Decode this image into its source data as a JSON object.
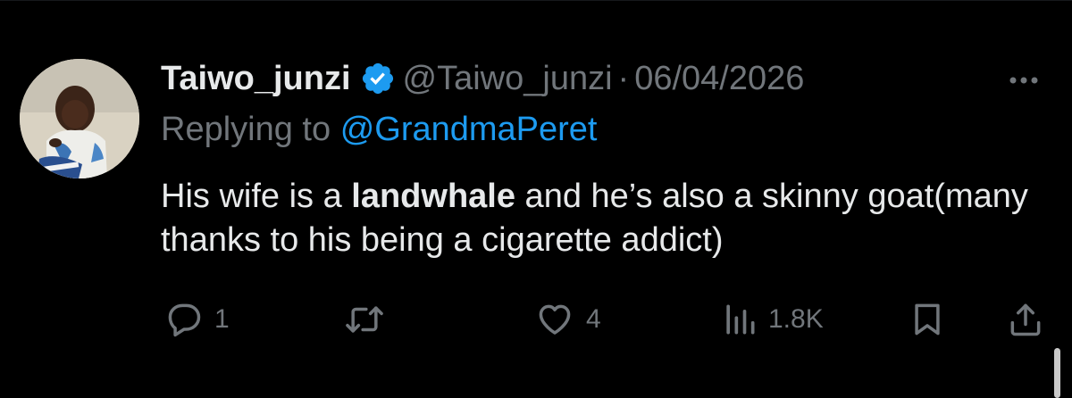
{
  "tweet": {
    "display_name": "Taiwo_junzi",
    "handle": "@Taiwo_junzi",
    "separator": "·",
    "date": "06/04/2026",
    "replying_prefix": "Replying to",
    "replying_to": "@GrandmaPeret",
    "text_part1": "His wife is a ",
    "text_bold": "landwhale",
    "text_part2": " and he’s also a skinny goat(many thanks to his being a cigarette addict)"
  },
  "actions": {
    "reply_count": "1",
    "retweet_count": "",
    "like_count": "4",
    "views_count": "1.8K"
  },
  "icons": {
    "verified": "verified-badge-icon",
    "more": "more-dots-icon",
    "reply": "reply-bubble-icon",
    "retweet": "retweet-icon",
    "like": "heart-icon",
    "views": "views-bar-chart-icon",
    "bookmark": "bookmark-icon",
    "share": "share-upload-icon"
  },
  "colors": {
    "background": "#000000",
    "text_primary": "#e7e9ea",
    "text_secondary": "#71767b",
    "accent": "#1d9bf0"
  }
}
